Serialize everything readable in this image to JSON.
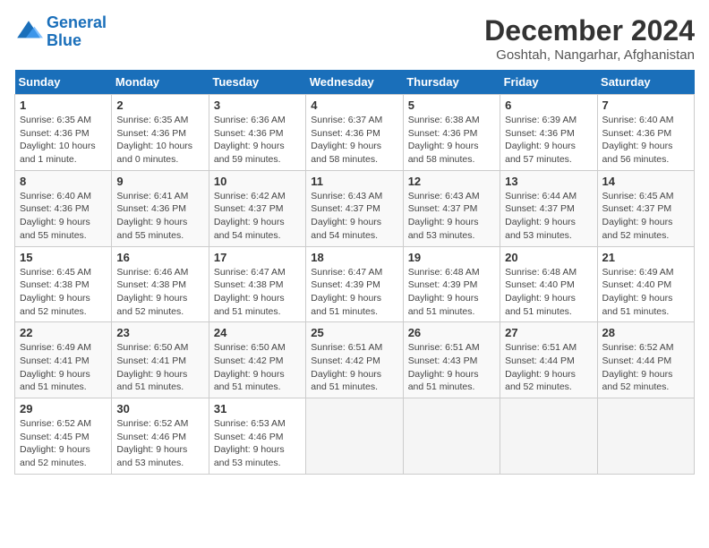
{
  "header": {
    "logo_line1": "General",
    "logo_line2": "Blue",
    "month": "December 2024",
    "location": "Goshtah, Nangarhar, Afghanistan"
  },
  "days_of_week": [
    "Sunday",
    "Monday",
    "Tuesday",
    "Wednesday",
    "Thursday",
    "Friday",
    "Saturday"
  ],
  "weeks": [
    [
      {
        "day": "1",
        "sunrise": "6:35 AM",
        "sunset": "4:36 PM",
        "daylight": "10 hours and 1 minute."
      },
      {
        "day": "2",
        "sunrise": "6:35 AM",
        "sunset": "4:36 PM",
        "daylight": "10 hours and 0 minutes."
      },
      {
        "day": "3",
        "sunrise": "6:36 AM",
        "sunset": "4:36 PM",
        "daylight": "9 hours and 59 minutes."
      },
      {
        "day": "4",
        "sunrise": "6:37 AM",
        "sunset": "4:36 PM",
        "daylight": "9 hours and 58 minutes."
      },
      {
        "day": "5",
        "sunrise": "6:38 AM",
        "sunset": "4:36 PM",
        "daylight": "9 hours and 58 minutes."
      },
      {
        "day": "6",
        "sunrise": "6:39 AM",
        "sunset": "4:36 PM",
        "daylight": "9 hours and 57 minutes."
      },
      {
        "day": "7",
        "sunrise": "6:40 AM",
        "sunset": "4:36 PM",
        "daylight": "9 hours and 56 minutes."
      }
    ],
    [
      {
        "day": "8",
        "sunrise": "6:40 AM",
        "sunset": "4:36 PM",
        "daylight": "9 hours and 55 minutes."
      },
      {
        "day": "9",
        "sunrise": "6:41 AM",
        "sunset": "4:36 PM",
        "daylight": "9 hours and 55 minutes."
      },
      {
        "day": "10",
        "sunrise": "6:42 AM",
        "sunset": "4:37 PM",
        "daylight": "9 hours and 54 minutes."
      },
      {
        "day": "11",
        "sunrise": "6:43 AM",
        "sunset": "4:37 PM",
        "daylight": "9 hours and 54 minutes."
      },
      {
        "day": "12",
        "sunrise": "6:43 AM",
        "sunset": "4:37 PM",
        "daylight": "9 hours and 53 minutes."
      },
      {
        "day": "13",
        "sunrise": "6:44 AM",
        "sunset": "4:37 PM",
        "daylight": "9 hours and 53 minutes."
      },
      {
        "day": "14",
        "sunrise": "6:45 AM",
        "sunset": "4:37 PM",
        "daylight": "9 hours and 52 minutes."
      }
    ],
    [
      {
        "day": "15",
        "sunrise": "6:45 AM",
        "sunset": "4:38 PM",
        "daylight": "9 hours and 52 minutes."
      },
      {
        "day": "16",
        "sunrise": "6:46 AM",
        "sunset": "4:38 PM",
        "daylight": "9 hours and 52 minutes."
      },
      {
        "day": "17",
        "sunrise": "6:47 AM",
        "sunset": "4:38 PM",
        "daylight": "9 hours and 51 minutes."
      },
      {
        "day": "18",
        "sunrise": "6:47 AM",
        "sunset": "4:39 PM",
        "daylight": "9 hours and 51 minutes."
      },
      {
        "day": "19",
        "sunrise": "6:48 AM",
        "sunset": "4:39 PM",
        "daylight": "9 hours and 51 minutes."
      },
      {
        "day": "20",
        "sunrise": "6:48 AM",
        "sunset": "4:40 PM",
        "daylight": "9 hours and 51 minutes."
      },
      {
        "day": "21",
        "sunrise": "6:49 AM",
        "sunset": "4:40 PM",
        "daylight": "9 hours and 51 minutes."
      }
    ],
    [
      {
        "day": "22",
        "sunrise": "6:49 AM",
        "sunset": "4:41 PM",
        "daylight": "9 hours and 51 minutes."
      },
      {
        "day": "23",
        "sunrise": "6:50 AM",
        "sunset": "4:41 PM",
        "daylight": "9 hours and 51 minutes."
      },
      {
        "day": "24",
        "sunrise": "6:50 AM",
        "sunset": "4:42 PM",
        "daylight": "9 hours and 51 minutes."
      },
      {
        "day": "25",
        "sunrise": "6:51 AM",
        "sunset": "4:42 PM",
        "daylight": "9 hours and 51 minutes."
      },
      {
        "day": "26",
        "sunrise": "6:51 AM",
        "sunset": "4:43 PM",
        "daylight": "9 hours and 51 minutes."
      },
      {
        "day": "27",
        "sunrise": "6:51 AM",
        "sunset": "4:44 PM",
        "daylight": "9 hours and 52 minutes."
      },
      {
        "day": "28",
        "sunrise": "6:52 AM",
        "sunset": "4:44 PM",
        "daylight": "9 hours and 52 minutes."
      }
    ],
    [
      {
        "day": "29",
        "sunrise": "6:52 AM",
        "sunset": "4:45 PM",
        "daylight": "9 hours and 52 minutes."
      },
      {
        "day": "30",
        "sunrise": "6:52 AM",
        "sunset": "4:46 PM",
        "daylight": "9 hours and 53 minutes."
      },
      {
        "day": "31",
        "sunrise": "6:53 AM",
        "sunset": "4:46 PM",
        "daylight": "9 hours and 53 minutes."
      },
      null,
      null,
      null,
      null
    ]
  ]
}
